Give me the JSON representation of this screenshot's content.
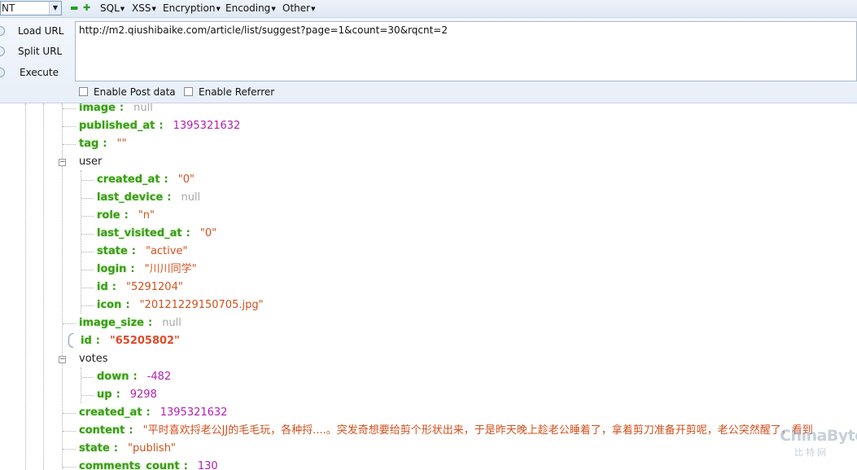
{
  "toolbar": {
    "dropdown_value": "NT",
    "menus": [
      {
        "label": "SQL"
      },
      {
        "label": "XSS"
      },
      {
        "label": "Encryption"
      },
      {
        "label": "Encoding"
      },
      {
        "label": "Other"
      }
    ],
    "icons": [
      "minus-icon",
      "plus-icon"
    ]
  },
  "actions": {
    "load_url": "Load URL",
    "split_url": "Split URL",
    "execute": "Execute"
  },
  "url": "http://m2.qiushibaike.com/article/list/suggest?page=1&count=30&rqcnt=2",
  "options": {
    "enable_post": "Enable Post data",
    "enable_referrer": "Enable Referrer",
    "enable_post_checked": false,
    "enable_referrer_checked": false
  },
  "tree": {
    "rows": [
      {
        "key": "image",
        "value": "null",
        "type": "null"
      },
      {
        "key": "published_at",
        "value": "1395321632",
        "type": "num"
      },
      {
        "key": "tag",
        "value": "\"\"",
        "type": "str"
      },
      {
        "name": "user"
      },
      {
        "key": "created_at",
        "value": "\"0\"",
        "type": "str"
      },
      {
        "key": "last_device",
        "value": "null",
        "type": "null"
      },
      {
        "key": "role",
        "value": "\"n\"",
        "type": "str"
      },
      {
        "key": "last_visited_at",
        "value": "\"0\"",
        "type": "str"
      },
      {
        "key": "state",
        "value": "\"active\"",
        "type": "str"
      },
      {
        "key": "login",
        "value": "\"川川同学\"",
        "type": "str"
      },
      {
        "key": "id",
        "value": "\"5291204\"",
        "type": "str"
      },
      {
        "key": "icon",
        "value": "\"20121229150705.jpg\"",
        "type": "str"
      },
      {
        "key": "image_size",
        "value": "null",
        "type": "null"
      },
      {
        "key": "id",
        "value": "\"65205802\"",
        "type": "str",
        "highlight": true
      },
      {
        "name": "votes"
      },
      {
        "key": "down",
        "value": "-482",
        "type": "num"
      },
      {
        "key": "up",
        "value": "9298",
        "type": "num"
      },
      {
        "key": "created_at",
        "value": "1395321632",
        "type": "num"
      },
      {
        "key": "content",
        "value": "\"平时喜欢捋老公JJ的毛毛玩，各种捋....。突发奇想要给剪个形状出来，于是昨天晚上趁老公睡着了，拿着剪刀准备开剪呢，老公突然醒了，看到",
        "type": "str"
      },
      {
        "key": "state",
        "value": "\"publish\"",
        "type": "str"
      },
      {
        "key": "comments_count",
        "value": "130",
        "type": "num"
      }
    ]
  },
  "watermark": {
    "line1": "ChinaByte",
    "line2": "比特网"
  },
  "colors": {
    "key": "#3a9a1a",
    "string": "#d0501c",
    "number": "#b020b0",
    "null": "#a8a8a8"
  }
}
